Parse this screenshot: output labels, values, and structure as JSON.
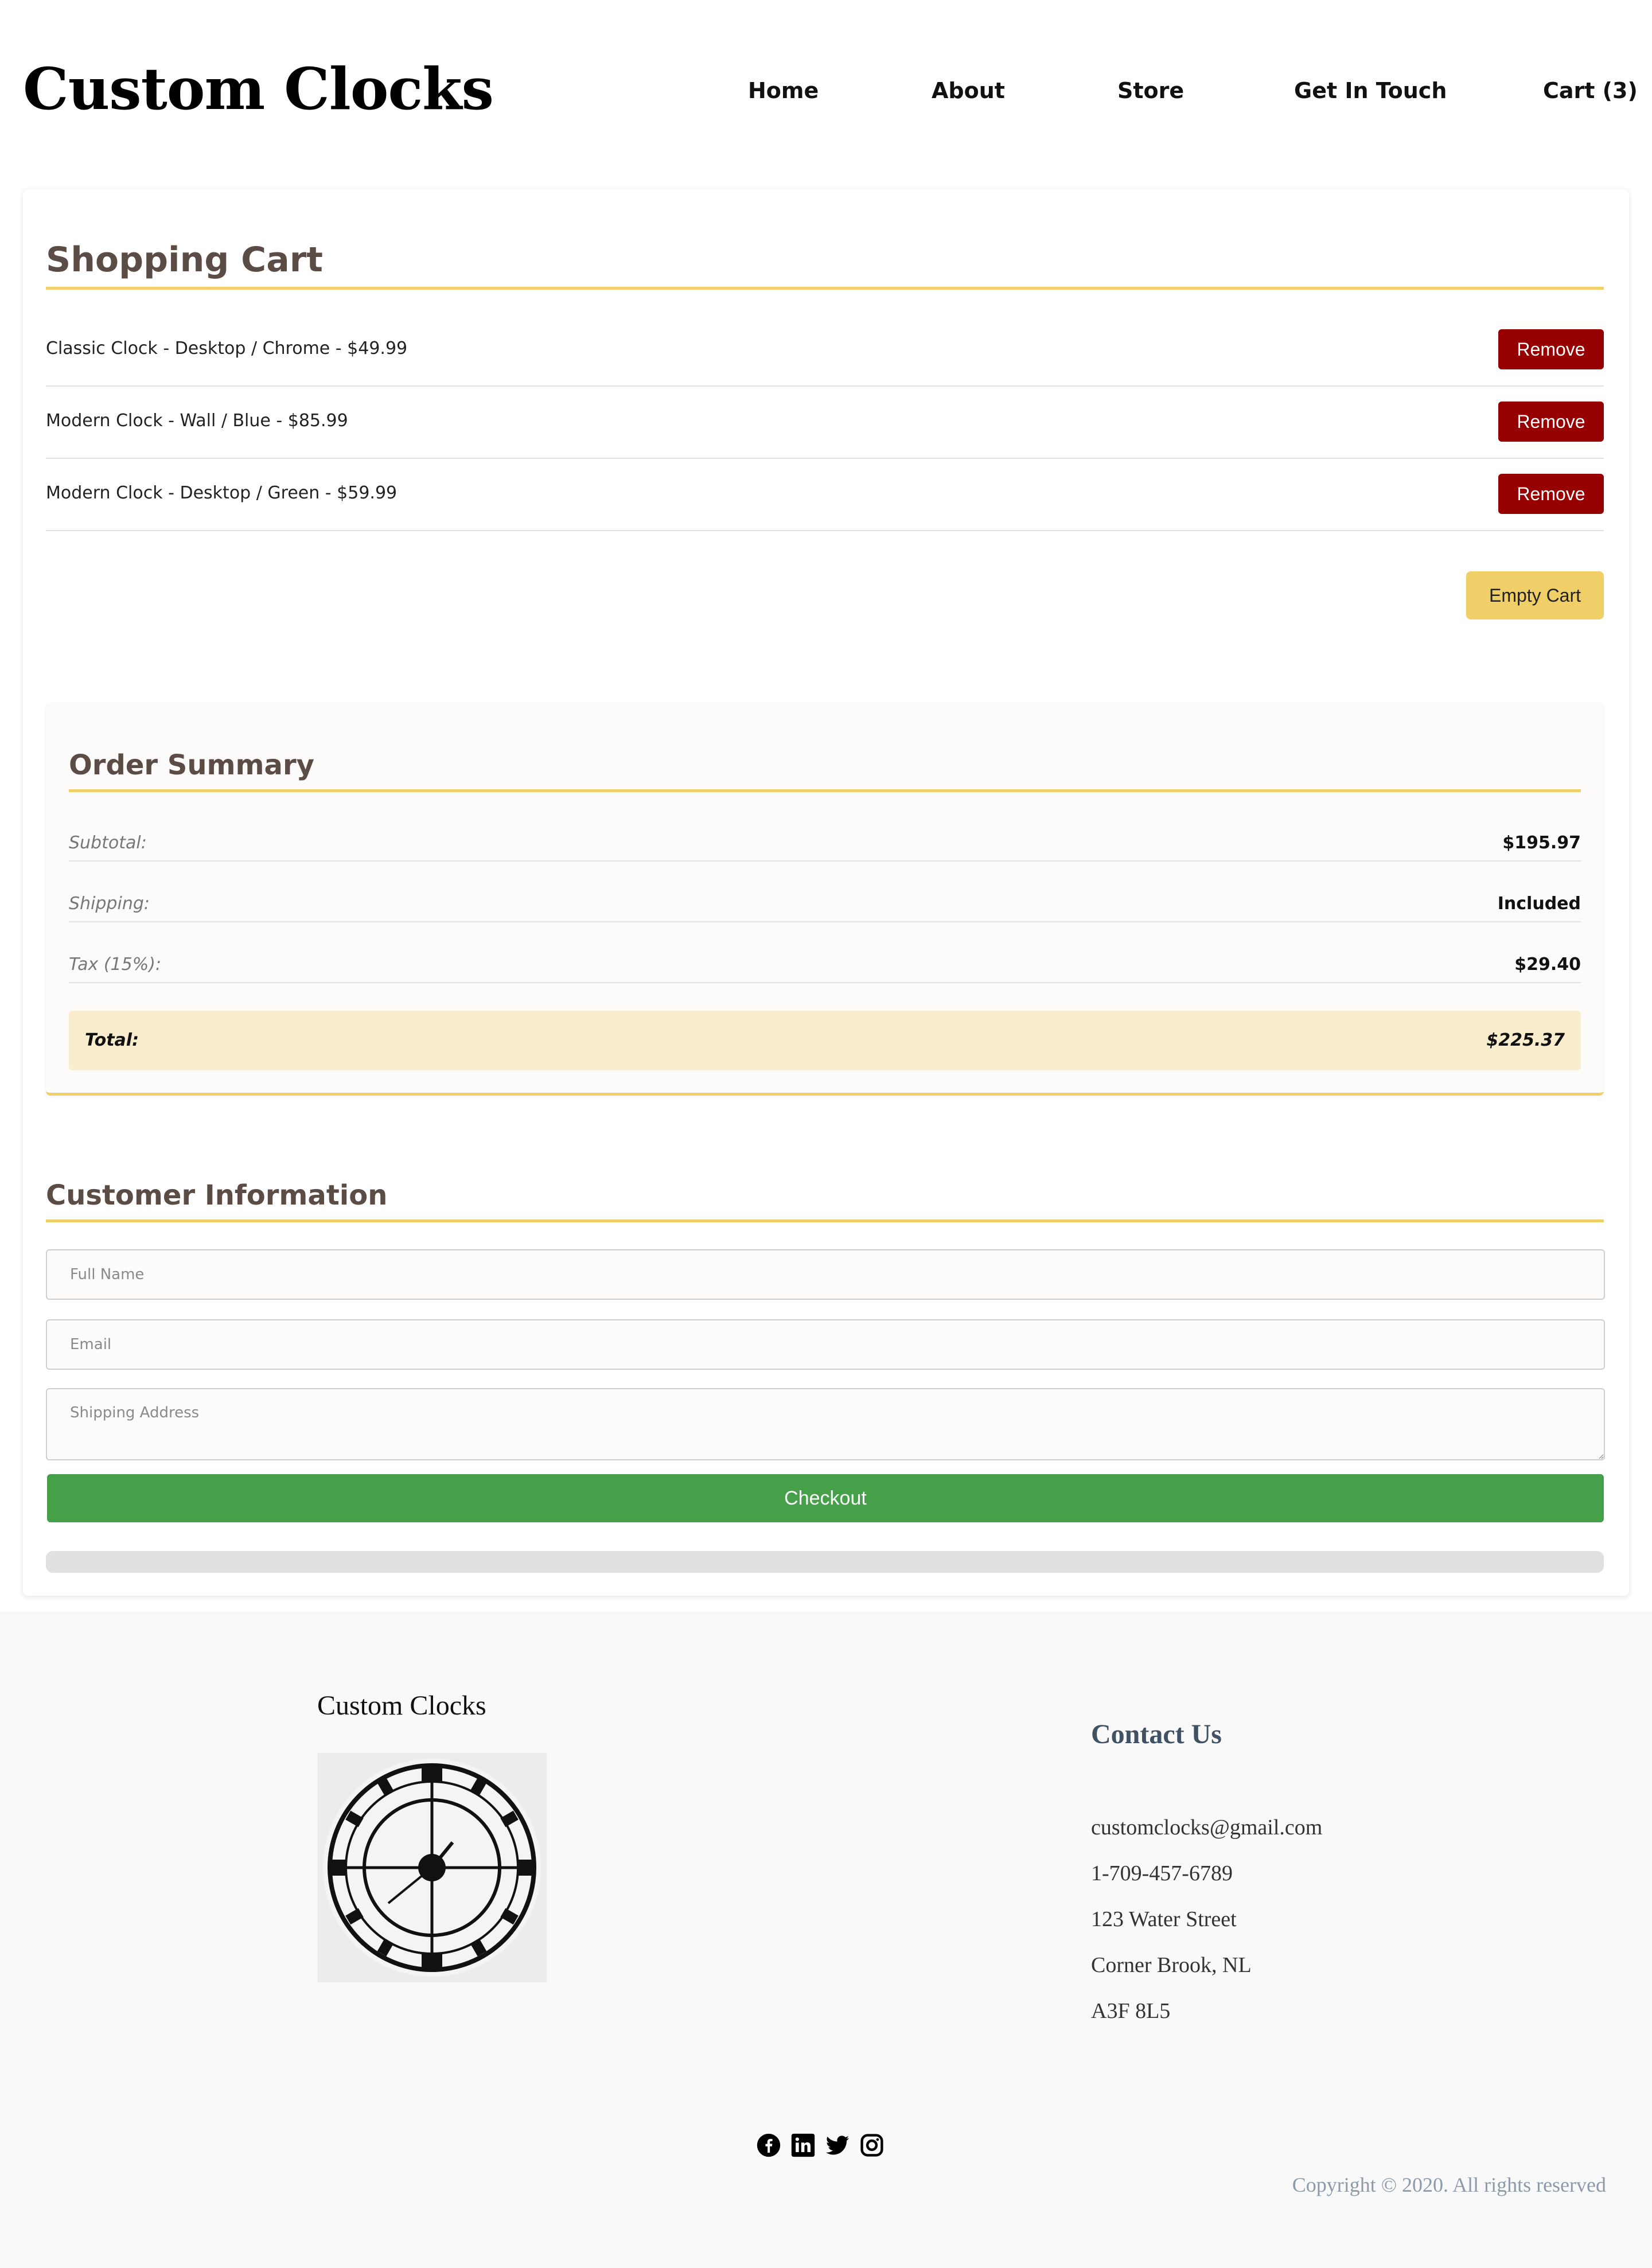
{
  "brand": "Custom Clocks",
  "nav": {
    "items": [
      "Home",
      "About",
      "Store",
      "Get In Touch",
      "Cart (3)"
    ]
  },
  "cart": {
    "title": "Shopping Cart",
    "items": [
      "Classic Clock - Desktop / Chrome - $49.99",
      "Modern Clock - Wall / Blue - $85.99",
      "Modern Clock - Desktop / Green - $59.99"
    ],
    "remove_label": "Remove",
    "empty_label": "Empty Cart"
  },
  "summary": {
    "title": "Order Summary",
    "subtotal_label": "Subtotal:",
    "subtotal_value": "$195.97",
    "shipping_label": "Shipping:",
    "shipping_value": "Included",
    "tax_label": "Tax (15%):",
    "tax_value": "$29.40",
    "total_label": "Total:",
    "total_value": "$225.37"
  },
  "customer": {
    "title": "Customer Information",
    "name_placeholder": "Full Name",
    "email_placeholder": "Email",
    "address_placeholder": "Shipping Address",
    "checkout_label": "Checkout",
    "progress": 0
  },
  "footer": {
    "brand": "Custom Clocks",
    "contact_title": "Contact Us",
    "email": "customclocks@gmail.com",
    "phone": "1-709-457-6789",
    "street": "123 Water Street",
    "city": "Corner Brook, NL",
    "postal": "A3F 8L5",
    "socials": [
      "facebook-icon",
      "linkedin-icon",
      "twitter-icon",
      "instagram-icon"
    ],
    "copyright": "Copyright © 2020. All rights reserved"
  },
  "colors": {
    "accent_gold": "#f0cf69",
    "remove_red": "#960000",
    "checkout_green": "#45a049",
    "heading_brown": "#5b4c45",
    "total_bg": "#f9edce"
  }
}
